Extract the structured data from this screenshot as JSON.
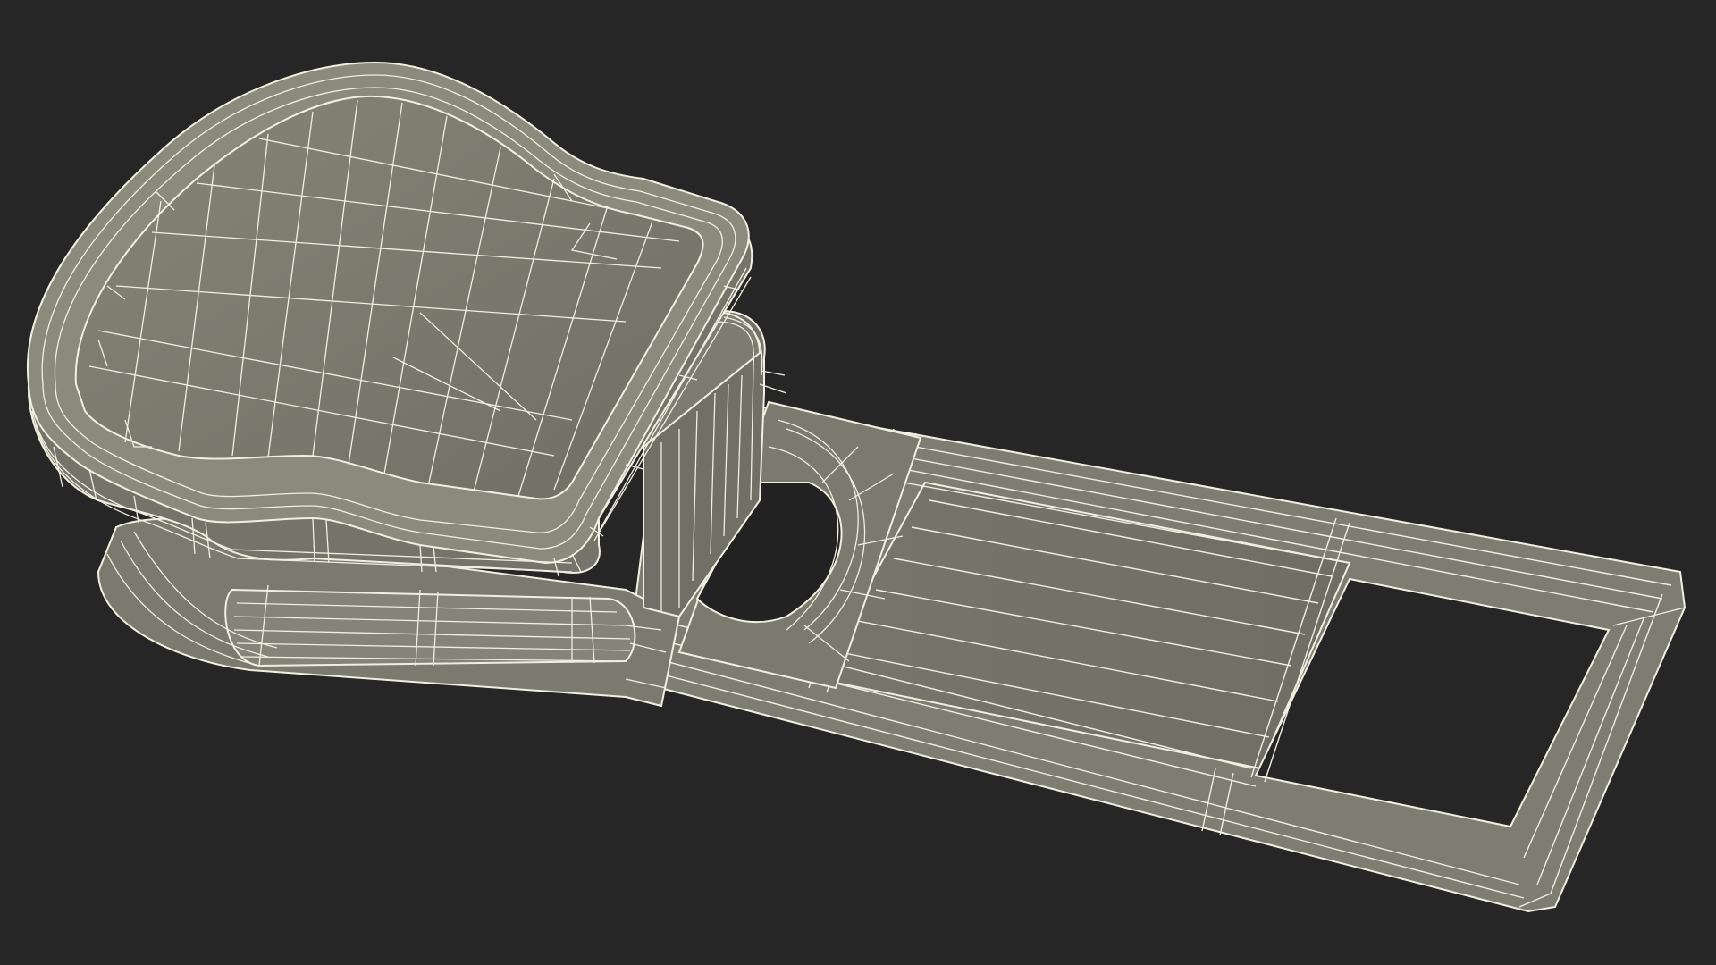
{
  "scene": {
    "background_color": "#262626",
    "surface_color": "#7b7b6f",
    "surface_dark_color": "#6a6a60",
    "edge_color": "#8e8e82",
    "wire_color": "#f1efe0",
    "hole_color": "#222222"
  }
}
